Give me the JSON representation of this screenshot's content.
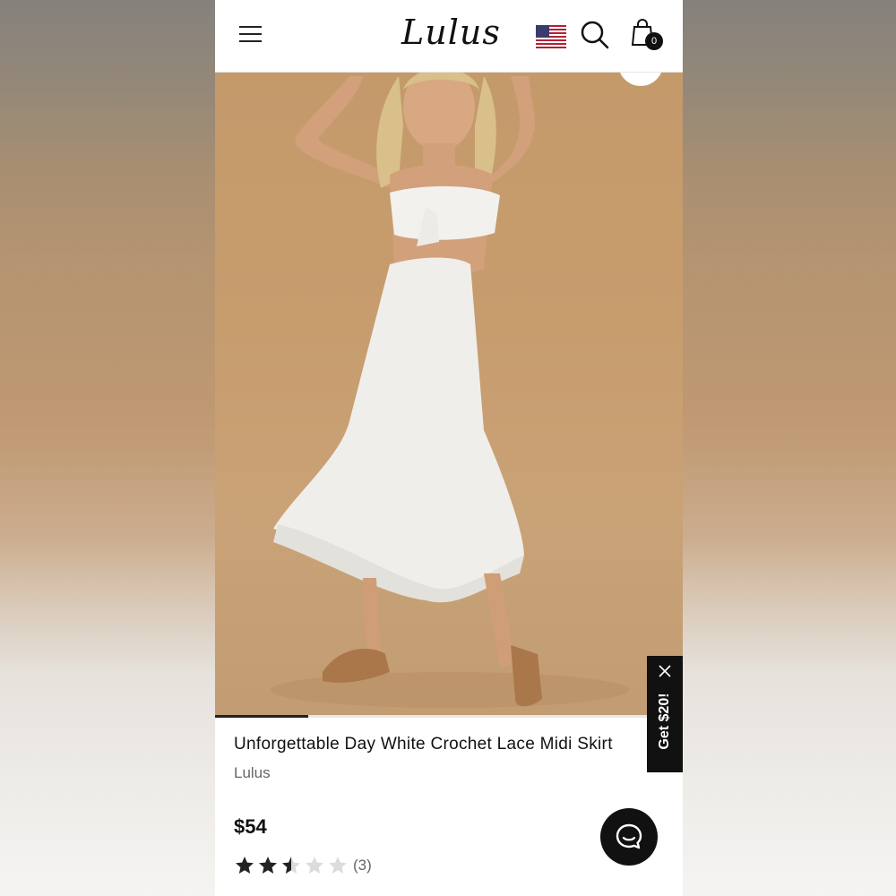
{
  "header": {
    "logo_text": "Lulus",
    "cart_count": "0",
    "icons": [
      "menu-icon",
      "us-flag-icon",
      "search-icon",
      "shopping-bag-icon"
    ]
  },
  "gallery": {
    "progress_fraction": 0.2
  },
  "promo": {
    "label": "Get $20!"
  },
  "product": {
    "title": "Unforgettable Day White Crochet Lace Midi Skirt",
    "brand": "Lulus",
    "price": "$54",
    "rating": 2.5,
    "rating_max": 5,
    "review_count": "(3)"
  },
  "colors": {
    "accent": "#111111",
    "photo_background": "#c49a6b"
  }
}
